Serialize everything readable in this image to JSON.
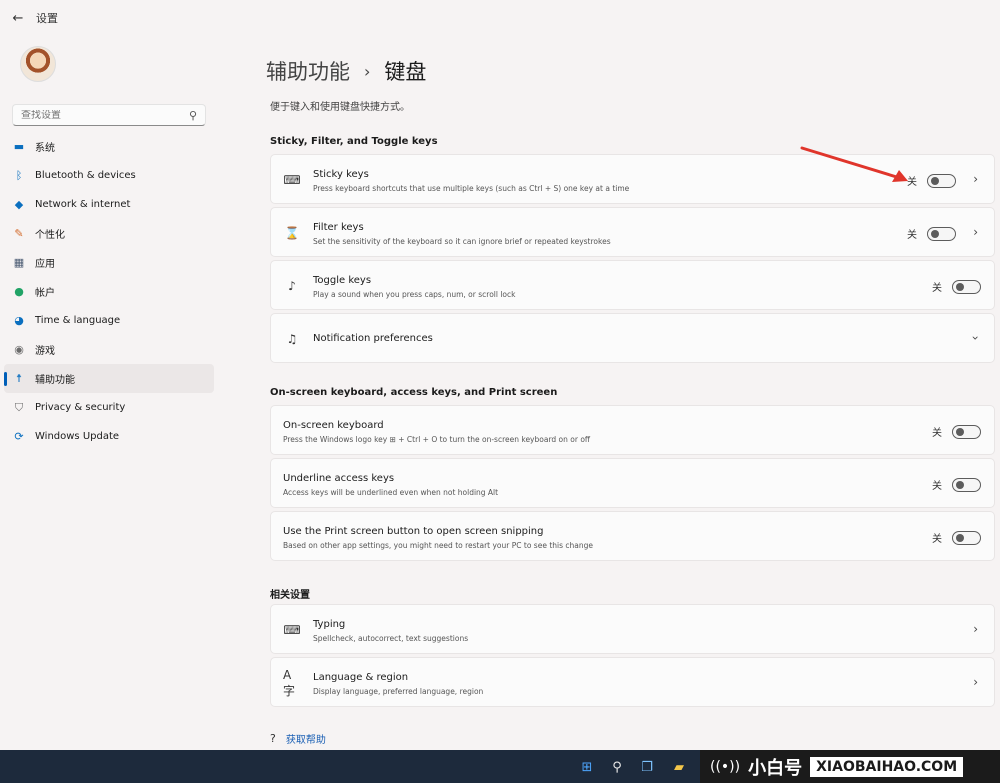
{
  "app": {
    "title": "设置",
    "back_icon": "back-arrow-icon"
  },
  "search": {
    "placeholder": "查找设置"
  },
  "nav": {
    "items": [
      {
        "label": "系统",
        "icon": "monitor-icon",
        "color": "#0b6fbf"
      },
      {
        "label": "Bluetooth & devices",
        "icon": "bluetooth-icon",
        "color": "#0b6fbf"
      },
      {
        "label": "Network & internet",
        "icon": "wifi-icon",
        "color": "#0b6fbf"
      },
      {
        "label": "个性化",
        "icon": "brush-icon",
        "color": "#d36b2b"
      },
      {
        "label": "应用",
        "icon": "apps-icon",
        "color": "#4a5a72"
      },
      {
        "label": "帐户",
        "icon": "person-icon",
        "color": "#21a366"
      },
      {
        "label": "Time & language",
        "icon": "globe-clock-icon",
        "color": "#0b6fbf"
      },
      {
        "label": "游戏",
        "icon": "gamepad-icon",
        "color": "#6b6b6b"
      },
      {
        "label": "辅助功能",
        "icon": "accessibility-icon",
        "color": "#0b6fbf",
        "active": true
      },
      {
        "label": "Privacy & security",
        "icon": "shield-icon",
        "color": "#6b6b6b"
      },
      {
        "label": "Windows Update",
        "icon": "update-icon",
        "color": "#0b6fbf"
      }
    ]
  },
  "page": {
    "breadcrumb_parent": "辅助功能",
    "breadcrumb_current": "键盘",
    "subtitle": "便于键入和使用键盘快捷方式。"
  },
  "sections": {
    "sticky_filter": "Sticky, Filter, and Toggle keys",
    "onscreen": "On-screen keyboard, access keys, and Print screen",
    "related": "相关设置"
  },
  "cards": {
    "sticky": {
      "title": "Sticky keys",
      "desc": "Press keyboard shortcuts that use multiple keys (such as Ctrl + S) one key at a time",
      "state": "关"
    },
    "filter": {
      "title": "Filter keys",
      "desc": "Set the sensitivity of the keyboard so it can ignore brief or repeated keystrokes",
      "state": "关"
    },
    "toggle": {
      "title": "Toggle keys",
      "desc": "Play a sound when you press caps, num, or scroll lock",
      "state": "关"
    },
    "notification": {
      "title": "Notification preferences"
    },
    "osk": {
      "title": "On-screen keyboard",
      "desc": "Press the Windows logo key ⊞ + Ctrl + O to turn the on-screen keyboard on or off",
      "state": "关"
    },
    "underline": {
      "title": "Underline access keys",
      "desc": "Access keys will be underlined even when not holding Alt",
      "state": "关"
    },
    "printscreen": {
      "title": "Use the Print screen button to open screen snipping",
      "desc": "Based on other app settings, you might need to restart your PC to see this change",
      "state": "关"
    },
    "typing": {
      "title": "Typing",
      "desc": "Spellcheck, autocorrect, text suggestions"
    },
    "language": {
      "title": "Language & region",
      "desc": "Display language, preferred language, region"
    }
  },
  "help": {
    "label": "获取帮助"
  },
  "watermark": {
    "brand_cn": "小白号",
    "domain": "XIAOBAIHAO.COM"
  },
  "colors": {
    "accent": "#005fb8",
    "arrow": "#e0352b",
    "taskbar": "#1d2a3c"
  }
}
